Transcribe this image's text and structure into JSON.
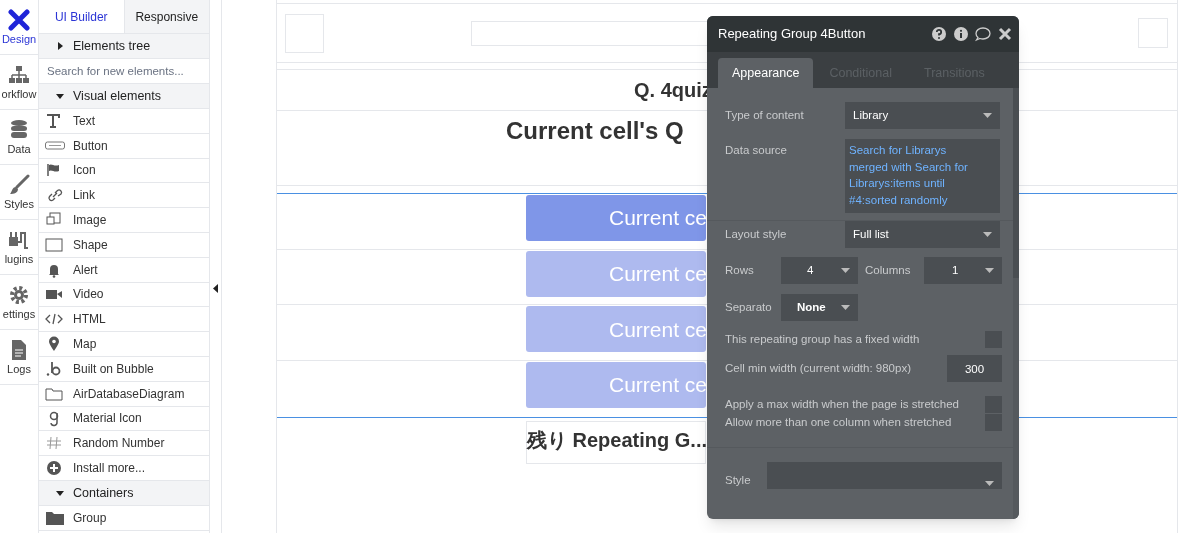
{
  "nav": [
    {
      "label": "Design",
      "selected": true
    },
    {
      "label": "orkflow",
      "selected": false
    },
    {
      "label": "Data",
      "selected": false
    },
    {
      "label": "Styles",
      "selected": false
    },
    {
      "label": "lugins",
      "selected": false
    },
    {
      "label": "ettings",
      "selected": false
    },
    {
      "label": "Logs",
      "selected": false
    }
  ],
  "panel_tabs": [
    {
      "label": "UI Builder",
      "selected": true
    },
    {
      "label": "Responsive",
      "selected": false
    }
  ],
  "elements_tree": {
    "label": "Elements tree",
    "expanded": false
  },
  "search": {
    "placeholder": "Search for new elements..."
  },
  "sections": [
    {
      "label": "Visual elements",
      "expanded": true,
      "items": [
        {
          "label": "Text"
        },
        {
          "label": "Button"
        },
        {
          "label": "Icon"
        },
        {
          "label": "Link"
        },
        {
          "label": "Image"
        },
        {
          "label": "Shape"
        },
        {
          "label": "Alert"
        },
        {
          "label": "Video"
        },
        {
          "label": "HTML"
        },
        {
          "label": "Map"
        },
        {
          "label": "Built on Bubble"
        },
        {
          "label": "AirDatabaseDiagram"
        },
        {
          "label": "Material Icon"
        },
        {
          "label": "Random Number"
        },
        {
          "label": "Install more..."
        }
      ]
    },
    {
      "label": "Containers",
      "expanded": true,
      "items": [
        {
          "label": "Group"
        }
      ]
    }
  ],
  "canvas": {
    "quiz_title": "Q. 4quiz",
    "question": "Current cell's Q",
    "answer_buttons": [
      {
        "label": "Current ce",
        "selected": true
      },
      {
        "label": "Current ce",
        "selected": false
      },
      {
        "label": "Current ce",
        "selected": false
      },
      {
        "label": "Current ce",
        "selected": false
      }
    ],
    "remaining": "残り Repeating G..."
  },
  "editor": {
    "title": "Repeating Group 4Button",
    "tabs": [
      {
        "label": "Appearance",
        "selected": true
      },
      {
        "label": "Conditional",
        "selected": false
      },
      {
        "label": "Transitions",
        "selected": false
      }
    ],
    "type_of_content": {
      "label": "Type of content",
      "value": "Library"
    },
    "data_source": {
      "label": "Data source",
      "value": "Search for Librarys merged with Search for Librarys:items until #4:sorted randomly"
    },
    "layout_style": {
      "label": "Layout style",
      "value": "Full list"
    },
    "rows": {
      "label": "Rows",
      "value": "4"
    },
    "columns": {
      "label": "Columns",
      "value": "1"
    },
    "separator": {
      "label": "Separato",
      "value": "None"
    },
    "fixed_width": {
      "label": "This repeating group has a fixed width",
      "checked": false
    },
    "cell_min_width": {
      "label": "Cell min width (current width: 980px)",
      "value": "300"
    },
    "max_width": {
      "label": "Apply a max width when the page is stretched",
      "checked": false
    },
    "multi_column": {
      "label": "Allow more than one column when stretched",
      "checked": false
    },
    "style": {
      "label": "Style"
    }
  }
}
